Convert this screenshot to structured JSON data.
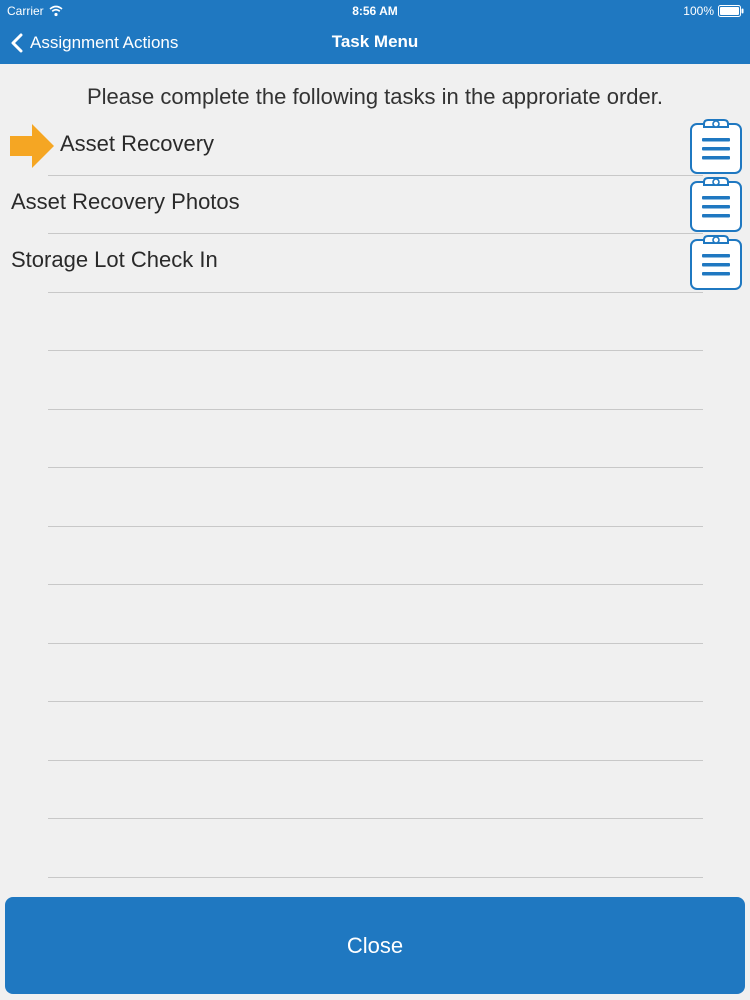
{
  "status_bar": {
    "carrier": "Carrier",
    "time": "8:56 AM",
    "battery": "100%"
  },
  "nav": {
    "back_label": "Assignment Actions",
    "title": "Task Menu"
  },
  "instructions": "Please complete the following tasks in the approriate order.",
  "tasks": [
    {
      "label": "Asset Recovery",
      "current": true,
      "icon": "clipboard-icon"
    },
    {
      "label": "Asset Recovery Photos",
      "current": false,
      "icon": "clipboard-icon"
    },
    {
      "label": "Storage Lot Check In",
      "current": false,
      "icon": "clipboard-icon"
    }
  ],
  "close_label": "Close",
  "colors": {
    "primary": "#1f78c1",
    "arrow": "#f5a623",
    "background": "#f0f0f0"
  }
}
